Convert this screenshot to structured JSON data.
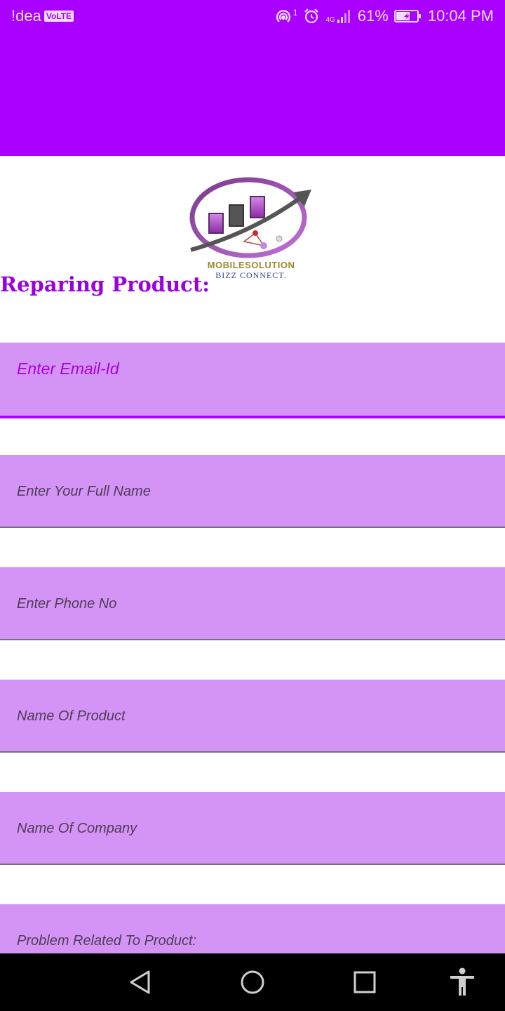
{
  "status_bar": {
    "carrier": "!dea",
    "volte_badge": "VoLTE",
    "hotspot_count": "1",
    "network_type": "4G",
    "battery": "61%",
    "time": "10:04 PM"
  },
  "logo": {
    "line1": "MOBILESOLUTION",
    "line2": "BIZZ CONNECT."
  },
  "page_title": "Reparing Product:",
  "form": {
    "email_placeholder": "Enter Email-Id",
    "name_placeholder": "Enter Your Full Name",
    "phone_placeholder": "Enter Phone No",
    "product_placeholder": "Name Of Product",
    "company_placeholder": "Name Of Company",
    "problem_placeholder": "Problem Related To Product:"
  },
  "colors": {
    "accent": "#aa00ff",
    "field_bg": "#d494f5",
    "title": "#9b00e0"
  },
  "nav": {
    "back": "back-icon",
    "home": "home-icon",
    "recents": "recents-icon",
    "accessibility": "accessibility-icon"
  }
}
